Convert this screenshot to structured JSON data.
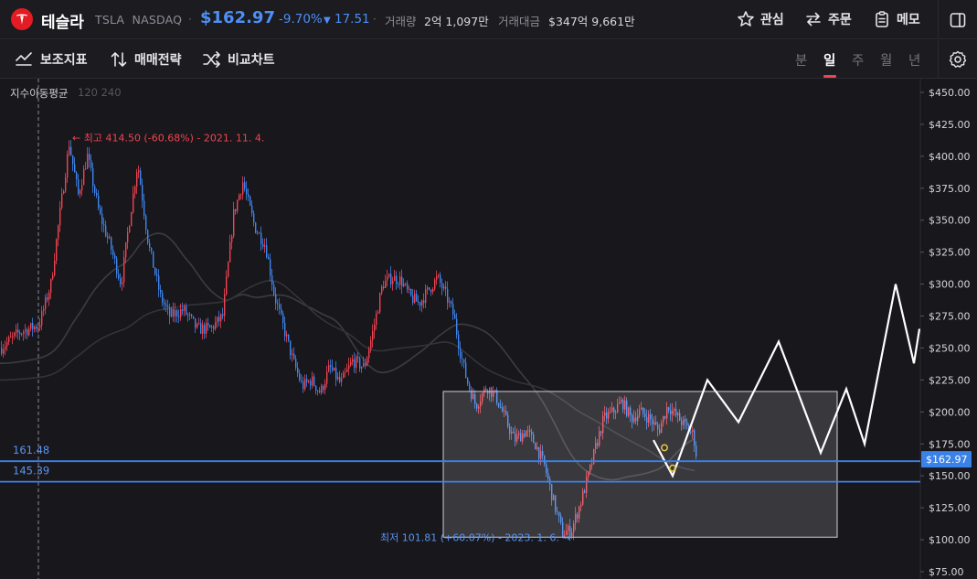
{
  "header": {
    "name": "테슬라",
    "ticker": "TSLA",
    "exchange": "NASDAQ",
    "sep": "·",
    "price": "$162.97",
    "change_pct": "-9.70%",
    "change_arrow": "▼",
    "change_abs": "17.51",
    "volume_label": "거래량",
    "volume_value": "2억 1,097만",
    "amount_label": "거래대금",
    "amount_value": "$347억 9,661만",
    "actions": {
      "watch": "관심",
      "order": "주문",
      "memo": "메모"
    }
  },
  "toolbar": {
    "indicators": "보조지표",
    "strategy": "매매전략",
    "compare": "비교차트",
    "periods": [
      "분",
      "일",
      "주",
      "월",
      "년"
    ],
    "active_period": "일"
  },
  "chart": {
    "indicator_label": "지수이동평균",
    "indicator_values": "120 240",
    "high_annotation": "← 최고 414.50 (-60.68%) - 2021. 11. 4.",
    "low_annotation": "최저 101.81 (+60.07%) - 2023. 1. 6. →",
    "current_price_tag": "$162.97",
    "hline_1": "161.48",
    "hline_2": "145.39",
    "colors": {
      "up": "#f04452",
      "down": "#3f86ef",
      "line": "#3b82e8",
      "background": "#17171c"
    }
  },
  "chart_data": {
    "type": "candlestick",
    "y_axis_ticks": [
      "$450.00",
      "$425.00",
      "$400.00",
      "$375.00",
      "$350.00",
      "$325.00",
      "$300.00",
      "$275.00",
      "$250.00",
      "$225.00",
      "$200.00",
      "$175.00",
      "$150.00",
      "$125.00",
      "$100.00",
      "$75.00"
    ],
    "ylim": [
      62,
      460
    ],
    "last_price": 162.97,
    "all_time_high": 414.5,
    "period_low": 101.81,
    "horizontal_lines": [
      161.48,
      145.39
    ],
    "price_path": [
      [
        0,
        250
      ],
      [
        20,
        262
      ],
      [
        42,
        268
      ],
      [
        55,
        300
      ],
      [
        63,
        345
      ],
      [
        75,
        410
      ],
      [
        85,
        370
      ],
      [
        95,
        400
      ],
      [
        108,
        355
      ],
      [
        120,
        330
      ],
      [
        132,
        300
      ],
      [
        140,
        345
      ],
      [
        150,
        395
      ],
      [
        162,
        330
      ],
      [
        175,
        290
      ],
      [
        185,
        275
      ],
      [
        200,
        280
      ],
      [
        215,
        265
      ],
      [
        230,
        265
      ],
      [
        243,
        275
      ],
      [
        255,
        355
      ],
      [
        265,
        380
      ],
      [
        278,
        345
      ],
      [
        290,
        330
      ],
      [
        300,
        290
      ],
      [
        310,
        265
      ],
      [
        320,
        240
      ],
      [
        330,
        220
      ],
      [
        340,
        225
      ],
      [
        350,
        215
      ],
      [
        360,
        235
      ],
      [
        372,
        222
      ],
      [
        385,
        240
      ],
      [
        398,
        235
      ],
      [
        408,
        265
      ],
      [
        418,
        300
      ],
      [
        428,
        305
      ],
      [
        438,
        303
      ],
      [
        448,
        290
      ],
      [
        458,
        285
      ],
      [
        468,
        295
      ],
      [
        478,
        305
      ],
      [
        488,
        290
      ],
      [
        496,
        275
      ],
      [
        502,
        250
      ],
      [
        510,
        225
      ],
      [
        520,
        205
      ],
      [
        532,
        220
      ],
      [
        542,
        212
      ],
      [
        552,
        195
      ],
      [
        562,
        178
      ],
      [
        575,
        185
      ],
      [
        585,
        175
      ],
      [
        595,
        158
      ],
      [
        605,
        130
      ],
      [
        615,
        105
      ],
      [
        625,
        108
      ],
      [
        635,
        130
      ],
      [
        645,
        155
      ],
      [
        652,
        175
      ],
      [
        660,
        195
      ],
      [
        670,
        200
      ],
      [
        680,
        208
      ],
      [
        690,
        195
      ],
      [
        700,
        200
      ],
      [
        710,
        195
      ],
      [
        720,
        185
      ],
      [
        730,
        205
      ],
      [
        738,
        198
      ],
      [
        748,
        190
      ],
      [
        758,
        182
      ],
      [
        762,
        163
      ]
    ],
    "projection_path": [
      [
        715,
        178
      ],
      [
        736,
        150
      ],
      [
        774,
        225
      ],
      [
        808,
        192
      ],
      [
        852,
        255
      ],
      [
        898,
        168
      ],
      [
        926,
        218
      ],
      [
        946,
        175
      ],
      [
        980,
        300
      ],
      [
        1000,
        238
      ],
      [
        1006,
        265
      ]
    ],
    "box": {
      "x0": 485,
      "x1": 916,
      "top_price": 216,
      "bottom_price": 102
    },
    "x_axis_ticks": []
  }
}
